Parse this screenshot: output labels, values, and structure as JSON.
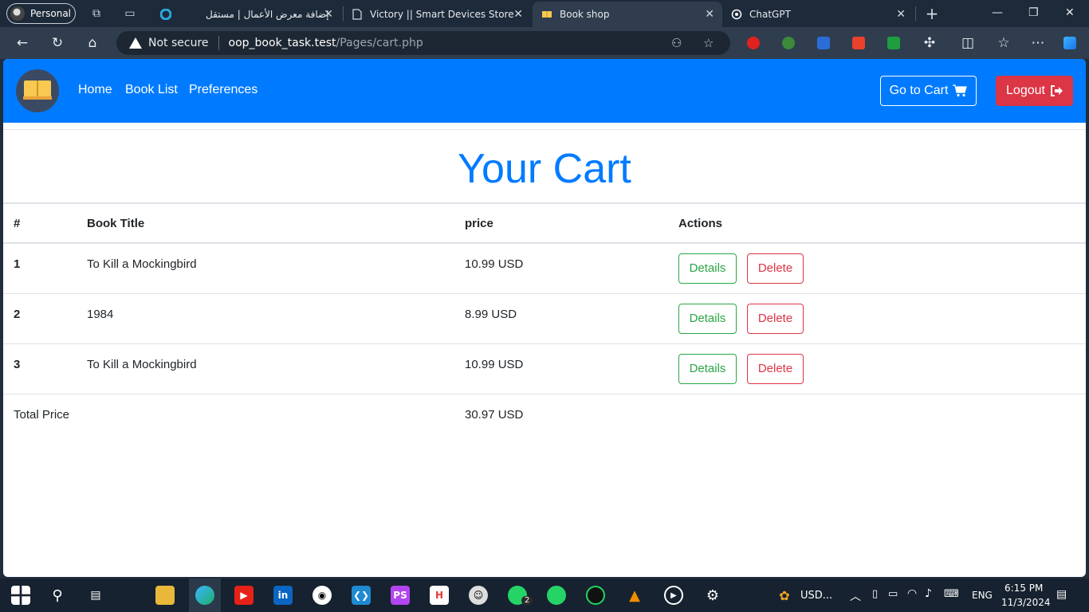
{
  "browser": {
    "profile_label": "Personal",
    "tabs": [
      {
        "title": "إضافة معرض الأعمال | مستقل",
        "icon": "mostaql-icon"
      },
      {
        "title": "Victory || Smart Devices Store",
        "icon": "page-icon"
      },
      {
        "title": "Book shop",
        "icon": "book-icon"
      },
      {
        "title": "ChatGPT",
        "icon": "chatgpt-icon"
      }
    ],
    "security_label": "Not secure",
    "url_host": "oop_book_task.test",
    "url_path": "/Pages/cart.php"
  },
  "navbar": {
    "links": [
      "Home",
      "Book List",
      "Preferences"
    ],
    "cart_button": "Go to Cart",
    "logout_button": "Logout"
  },
  "page": {
    "title": "Your Cart",
    "table": {
      "headers": [
        "#",
        "Book Title",
        "price",
        "Actions"
      ],
      "rows": [
        {
          "index": "1",
          "title": "To Kill a Mockingbird",
          "price": "10.99 USD"
        },
        {
          "index": "2",
          "title": "1984",
          "price": "8.99 USD"
        },
        {
          "index": "3",
          "title": "To Kill a Mockingbird",
          "price": "10.99 USD"
        }
      ],
      "details_label": "Details",
      "delete_label": "Delete",
      "total_label": "Total Price",
      "total_value": "30.97 USD"
    }
  },
  "taskbar": {
    "weather_text": "USD...",
    "language": "ENG",
    "time": "6:15 PM",
    "date": "11/3/2024",
    "whatsapp_badge": "2"
  },
  "colors": {
    "primary": "#007bff",
    "danger": "#dc3545",
    "success": "#28a745"
  }
}
